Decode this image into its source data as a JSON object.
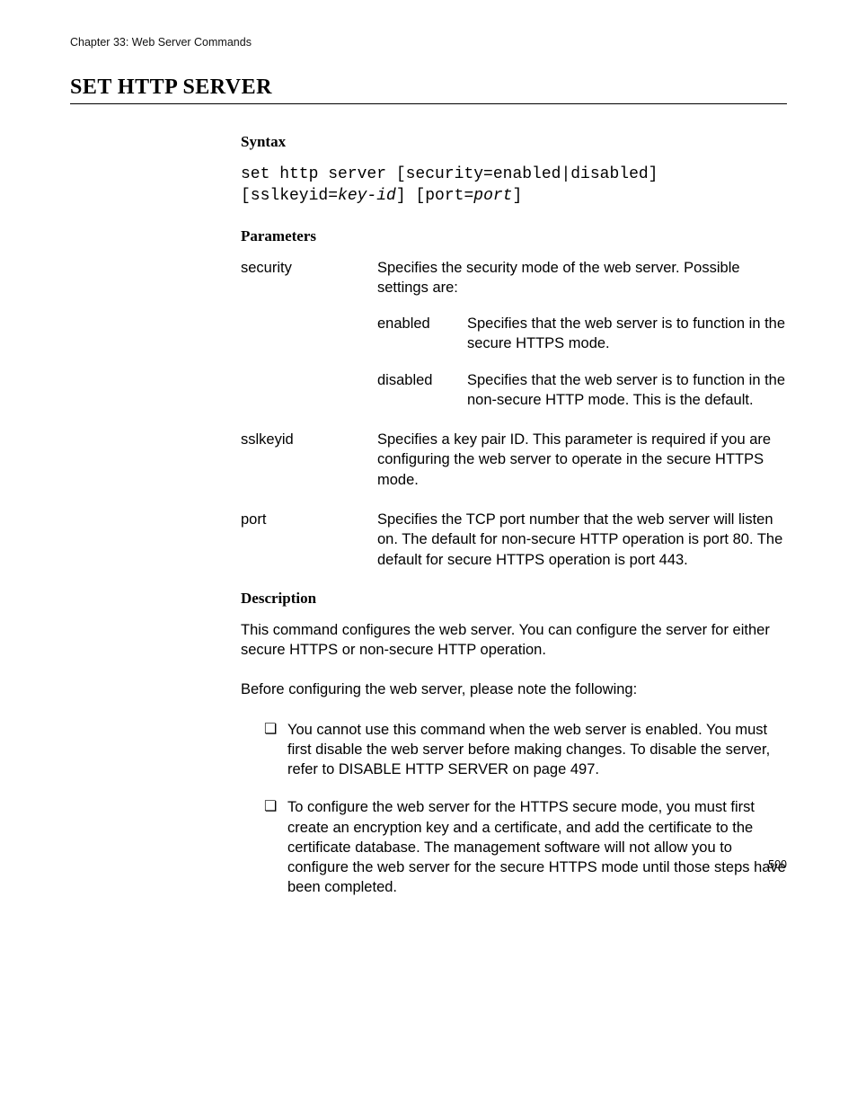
{
  "chapter_header": "Chapter 33: Web Server Commands",
  "title": "SET HTTP SERVER",
  "sections": {
    "syntax_h": "Syntax",
    "parameters_h": "Parameters",
    "description_h": "Description"
  },
  "syntax_plain1": "set http server [security=enabled|disabled]",
  "syntax_plain2a": "[sslkeyid=",
  "syntax_italic2a": "key-id",
  "syntax_plain2b": "] [port=",
  "syntax_italic2b": "port",
  "syntax_plain2c": "]",
  "params": {
    "security": {
      "name": "security",
      "desc_intro": "Specifies the security mode of the web server. Possible settings are:",
      "enabled": {
        "name": "enabled",
        "desc": "Specifies that the web server is to function in the secure HTTPS mode."
      },
      "disabled": {
        "name": "disabled",
        "desc": "Specifies that the web server is to function in the non-secure HTTP mode. This is the default."
      }
    },
    "sslkeyid": {
      "name": "sslkeyid",
      "desc": "Specifies a key pair ID. This parameter is required if you are configuring the web server to operate in the secure HTTPS mode."
    },
    "port": {
      "name": "port",
      "desc": "Specifies the TCP port number that the web server will listen on. The default for non-secure HTTP operation is port 80. The default for secure HTTPS operation is port 443."
    }
  },
  "description_p1": "This command configures the web server. You can configure the server for either secure HTTPS or non-secure HTTP operation.",
  "description_p2": "Before configuring the web server, please note the following:",
  "list": {
    "item1": "You cannot use this command when the web server is enabled. You must first disable the web server before making changes. To disable the server, refer to DISABLE HTTP SERVER on page 497.",
    "item2": "To configure the web server for the HTTPS secure mode, you must first create an encryption key and a certificate, and add the certificate to the certificate database. The management software will not allow you to configure the web server for the secure HTTPS mode until those steps have been completed."
  },
  "page_number": "500"
}
